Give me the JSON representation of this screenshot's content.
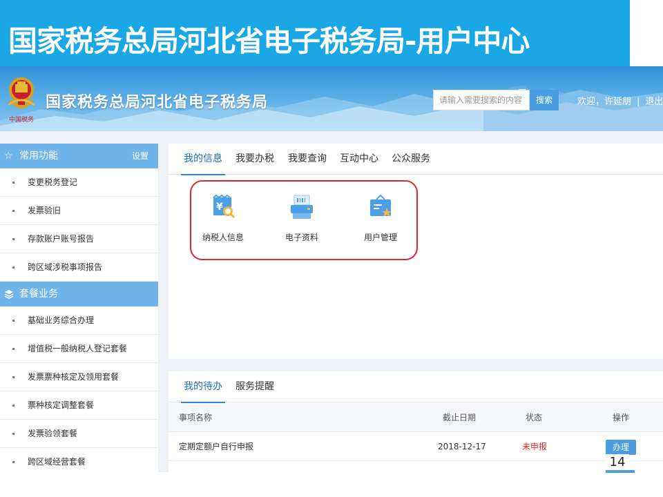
{
  "slide_title": "国家税务总局河北省电子税务局-用户中心",
  "header": {
    "site_name": "国家税务总局河北省电子税务局",
    "emblem_caption": "中国税务",
    "search_placeholder": "请输入需要搜索的内容",
    "search_button": "搜索",
    "welcome": "欢迎，许延朋",
    "separator": "|",
    "logout": "退出"
  },
  "sidebar": {
    "common": {
      "title": "常用功能",
      "settings": "设置",
      "items": [
        "变更税务登记",
        "发票验旧",
        "存款账户账号报告",
        "跨区域涉税事项报告"
      ]
    },
    "package": {
      "title": "套餐业务",
      "items": [
        "基础业务综合办理",
        "增值税一般纳税人登记套餐",
        "发票票种核定及领用套餐",
        "票种核定调整套餐",
        "发票验领套餐",
        "跨区域经营套餐"
      ]
    }
  },
  "main_tabs": [
    "我的信息",
    "我要办税",
    "我要查询",
    "互动中心",
    "公众服务"
  ],
  "functions": [
    {
      "label": "纳税人信息",
      "icon": "taxpayer-info-icon"
    },
    {
      "label": "电子资料",
      "icon": "electronic-data-icon"
    },
    {
      "label": "用户管理",
      "icon": "user-management-icon"
    }
  ],
  "todo": {
    "tabs": [
      "我的待办",
      "服务提醒"
    ],
    "columns": [
      "事项名称",
      "截止日期",
      "状态",
      "操作"
    ],
    "rows": [
      {
        "name": "定期定额户自行申报",
        "deadline": "2018-12-17",
        "status": "未申报",
        "action": "办理"
      }
    ]
  },
  "page_number": "14",
  "colors": {
    "banner": "#1aa7e6",
    "sidebar_header": "#6fb5ec",
    "accent": "#2f86d1",
    "status_red": "#e02a2a",
    "highlight_red": "#d9252a"
  }
}
